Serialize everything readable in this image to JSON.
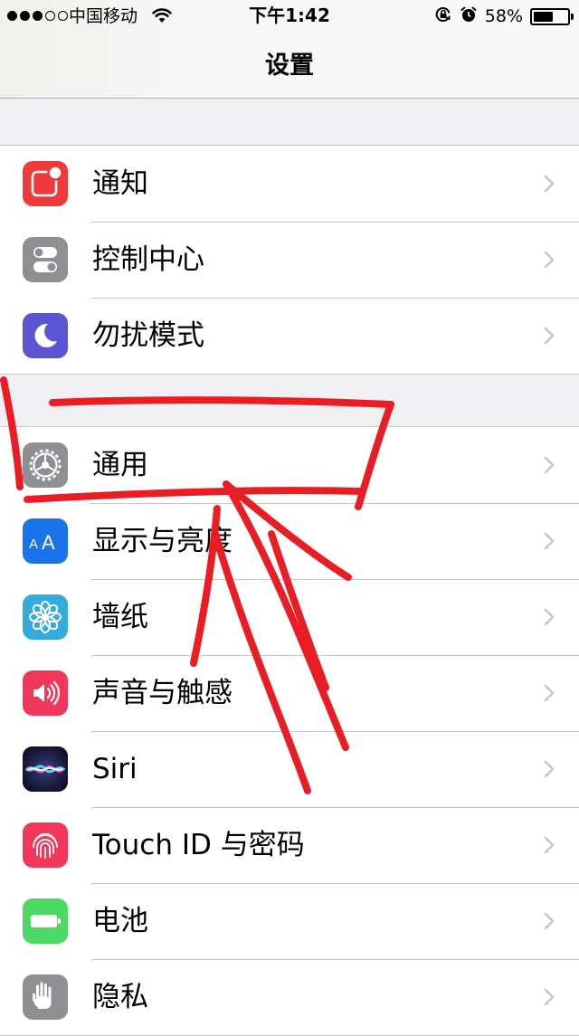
{
  "status_bar": {
    "carrier": "中国移动",
    "time": "下午1:42",
    "battery_percent": "58%",
    "battery_level": 0.58,
    "signal_bars": 3,
    "signal_total": 5,
    "icons": [
      "wifi-icon",
      "orientation-lock-icon",
      "alarm-icon",
      "battery-icon"
    ]
  },
  "nav": {
    "title": "设置"
  },
  "groups": [
    {
      "items": [
        {
          "label": "通知",
          "icon": "notifications-icon",
          "color": "#f0393a"
        },
        {
          "label": "控制中心",
          "icon": "control-center-icon",
          "color": "#8e8e93"
        },
        {
          "label": "勿扰模式",
          "icon": "moon-icon",
          "color": "#5a56d2"
        }
      ]
    },
    {
      "items": [
        {
          "label": "通用",
          "icon": "gear-icon",
          "color": "#8e8e93"
        },
        {
          "label": "显示与亮度",
          "icon": "display-brightness-icon",
          "color": "#1a73e8"
        },
        {
          "label": "墙纸",
          "icon": "wallpaper-flower-icon",
          "color": "#35aadc"
        },
        {
          "label": "声音与触感",
          "icon": "speaker-icon",
          "color": "#f2385a"
        },
        {
          "label": "Siri",
          "icon": "siri-icon",
          "color": "#1c1c3a"
        },
        {
          "label": "Touch ID 与密码",
          "icon": "fingerprint-icon",
          "color": "#f2385a"
        },
        {
          "label": "电池",
          "icon": "battery-setting-icon",
          "color": "#4cd964"
        },
        {
          "label": "隐私",
          "icon": "hand-icon",
          "color": "#8e8e93"
        }
      ]
    }
  ],
  "annotation": {
    "color": "#ea1c24",
    "description_icon": "red-arrow-annotation"
  }
}
